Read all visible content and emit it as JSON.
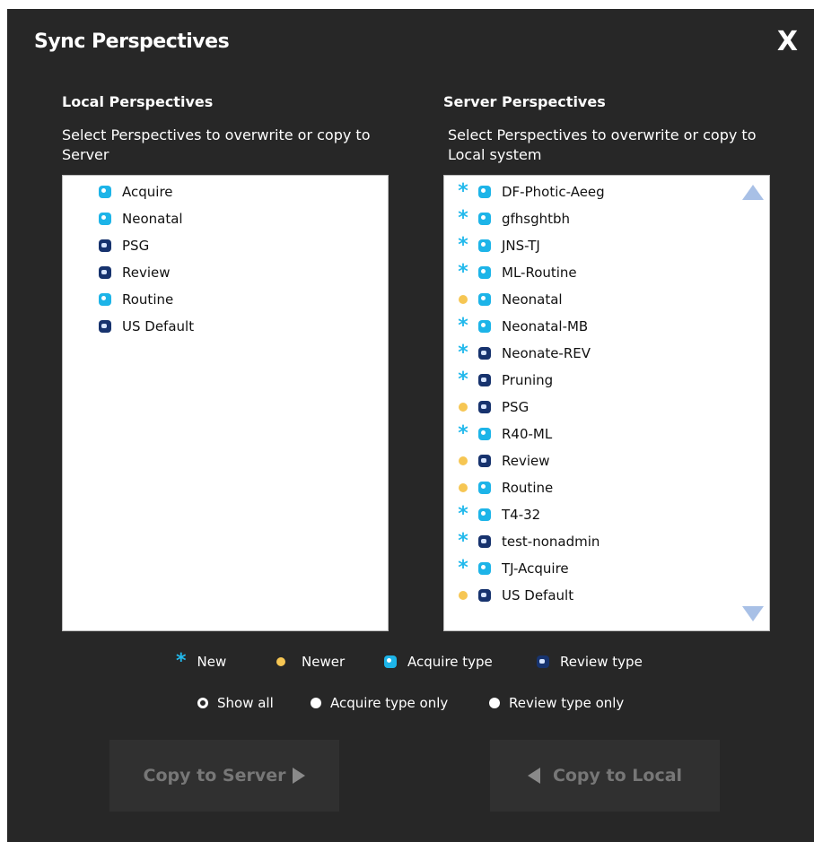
{
  "dialog": {
    "title": "Sync Perspectives",
    "close_label": "X"
  },
  "local": {
    "title": "Local Perspectives",
    "subtitle": "Select Perspectives to overwrite or copy to Server",
    "items": [
      {
        "label": "Acquire",
        "type": "acquire"
      },
      {
        "label": "Neonatal",
        "type": "acquire"
      },
      {
        "label": "PSG",
        "type": "review"
      },
      {
        "label": "Review",
        "type": "review"
      },
      {
        "label": "Routine",
        "type": "acquire"
      },
      {
        "label": "US Default",
        "type": "review"
      }
    ]
  },
  "server": {
    "title": "Server Perspectives",
    "subtitle": "Select Perspectives to overwrite or copy to Local system",
    "items": [
      {
        "label": "DF-Photic-Aeeg",
        "status": "new",
        "type": "acquire"
      },
      {
        "label": "gfhsghtbh",
        "status": "new",
        "type": "acquire"
      },
      {
        "label": "JNS-TJ",
        "status": "new",
        "type": "acquire"
      },
      {
        "label": "ML-Routine",
        "status": "new",
        "type": "acquire"
      },
      {
        "label": "Neonatal",
        "status": "newer",
        "type": "acquire"
      },
      {
        "label": "Neonatal-MB",
        "status": "new",
        "type": "acquire"
      },
      {
        "label": "Neonate-REV",
        "status": "new",
        "type": "review"
      },
      {
        "label": "Pruning",
        "status": "new",
        "type": "review"
      },
      {
        "label": "PSG",
        "status": "newer",
        "type": "review"
      },
      {
        "label": "R40-ML",
        "status": "new",
        "type": "acquire"
      },
      {
        "label": "Review",
        "status": "newer",
        "type": "review"
      },
      {
        "label": "Routine",
        "status": "newer",
        "type": "acquire"
      },
      {
        "label": "T4-32",
        "status": "new",
        "type": "acquire"
      },
      {
        "label": "test-nonadmin",
        "status": "new",
        "type": "review"
      },
      {
        "label": "TJ-Acquire",
        "status": "new",
        "type": "acquire"
      },
      {
        "label": "US Default",
        "status": "newer",
        "type": "review"
      }
    ]
  },
  "legend": {
    "new_label": "New",
    "newer_label": "Newer",
    "acquire_label": "Acquire type",
    "review_label": "Review type"
  },
  "filters": {
    "selected": "show_all",
    "show_all": "Show all",
    "acquire_only": "Acquire type only",
    "review_only": "Review type only"
  },
  "buttons": {
    "copy_to_server": "Copy to Server",
    "copy_to_local": "Copy to Local"
  },
  "colors": {
    "background": "#272727",
    "new_star": "#22b9ec",
    "newer_dot": "#f6c653",
    "acquire_icon": "#1db4e8",
    "review_icon": "#17336e"
  },
  "icons": {
    "new": "asterisk-icon",
    "newer": "dot-icon",
    "acquire": "acquire-type-icon",
    "review": "review-type-icon",
    "scroll_up": "triangle-up-icon",
    "scroll_down": "triangle-down-icon"
  }
}
